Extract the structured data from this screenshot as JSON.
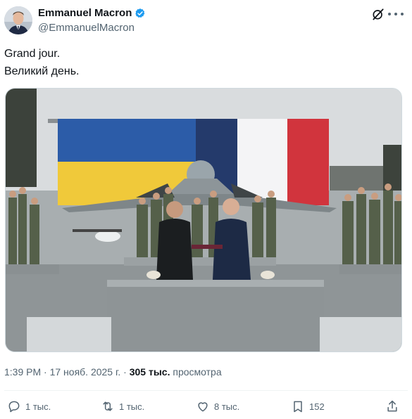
{
  "author": {
    "name": "Emmanuel Macron",
    "handle": "@EmmanuelMacron"
  },
  "post": {
    "lines": [
      "Grand jour.",
      "Великий день."
    ]
  },
  "meta": {
    "time": "1:39 PM",
    "sep": "·",
    "date": "17 нояб. 2025 г.",
    "views_value": "305 тыс.",
    "views_label": "просмотра"
  },
  "actions": {
    "replies": "1 тыс.",
    "reposts": "1 тыс.",
    "likes": "8 тыс.",
    "bookmarks": "152"
  },
  "colors": {
    "accent": "#1d9bf0",
    "muted": "#536471",
    "text": "#0f1419"
  },
  "icons": [
    "verified-badge-icon",
    "grok-icon",
    "more-icon",
    "reply-icon",
    "repost-icon",
    "like-icon",
    "bookmark-icon",
    "share-icon"
  ]
}
